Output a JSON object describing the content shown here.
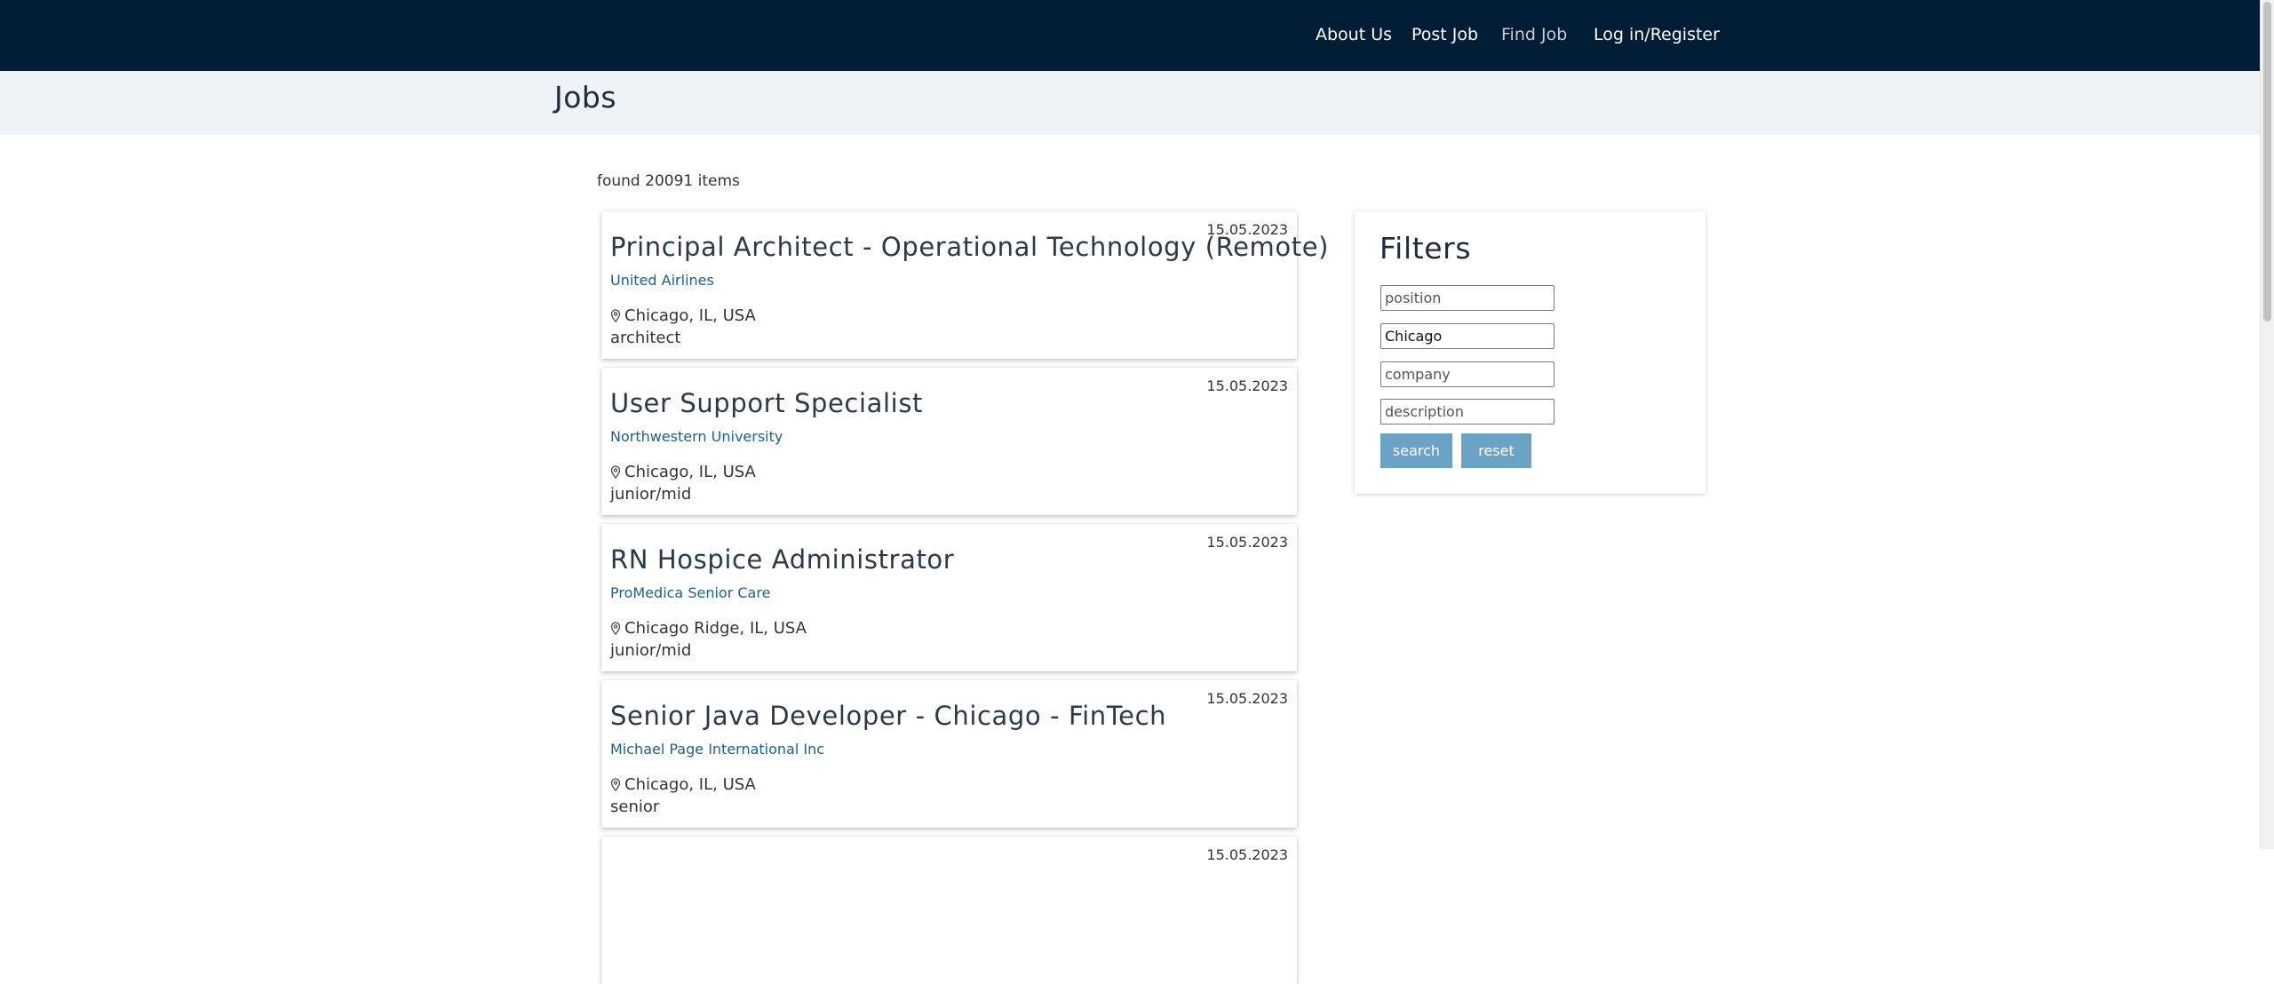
{
  "nav": {
    "about": "About Us",
    "post": "Post Job",
    "find": "Find Job",
    "login": "Log in/Register"
  },
  "page_title": "Jobs",
  "found_text": "found 20091 items",
  "jobs": [
    {
      "date": "15.05.2023",
      "title": "Principal Architect - Operational Technology (Remote)",
      "company": "United Airlines",
      "location": "Chicago, IL, USA",
      "level": "architect"
    },
    {
      "date": "15.05.2023",
      "title": "User Support Specialist",
      "company": "Northwestern University",
      "location": "Chicago, IL, USA",
      "level": "junior/mid"
    },
    {
      "date": "15.05.2023",
      "title": "RN Hospice Administrator",
      "company": "ProMedica Senior Care",
      "location": "Chicago Ridge, IL, USA",
      "level": "junior/mid"
    },
    {
      "date": "15.05.2023",
      "title": "Senior Java Developer - Chicago - FinTech",
      "company": "Michael Page International Inc",
      "location": "Chicago, IL, USA",
      "level": "senior"
    },
    {
      "date": "15.05.2023",
      "title": "",
      "company": "",
      "location": "",
      "level": ""
    }
  ],
  "filters": {
    "title": "Filters",
    "position_placeholder": "position",
    "location_value": "Chicago",
    "company_placeholder": "company",
    "description_placeholder": "description",
    "search_label": "search",
    "reset_label": "reset"
  },
  "colors": {
    "topbar": "#001d35",
    "subheader": "#edf3f6",
    "company_link": "#1f5f8b",
    "button": "#6aa3c5"
  },
  "icons": {
    "location": "map-pin-icon"
  }
}
